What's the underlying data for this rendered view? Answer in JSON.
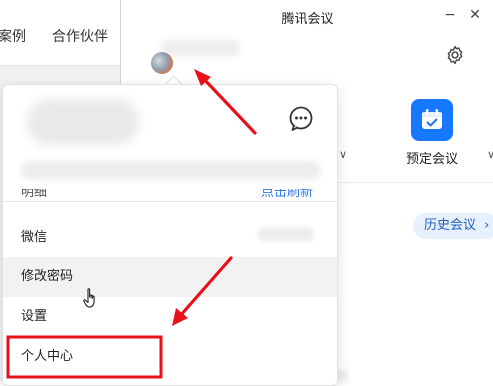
{
  "background_page": {
    "nav_items": [
      "案例",
      "合作伙伴"
    ]
  },
  "app": {
    "title": "腾讯会议",
    "window_buttons": {
      "minimize": "−",
      "close": "✕"
    },
    "schedule_label": "预定会议",
    "history_label": "历史会议",
    "history_chevron": "›"
  },
  "menu": {
    "partial_left": "明细",
    "partial_right": "点击刷新",
    "items": [
      "微信",
      "修改密码",
      "设置",
      "个人中心"
    ]
  },
  "colors": {
    "accent_blue": "#1677ff",
    "annotation_red": "#e8101a",
    "hover_bg": "#f2f2f2"
  },
  "icons": [
    "gear-icon",
    "calendar-icon",
    "message-icon",
    "hand-cursor-icon"
  ]
}
